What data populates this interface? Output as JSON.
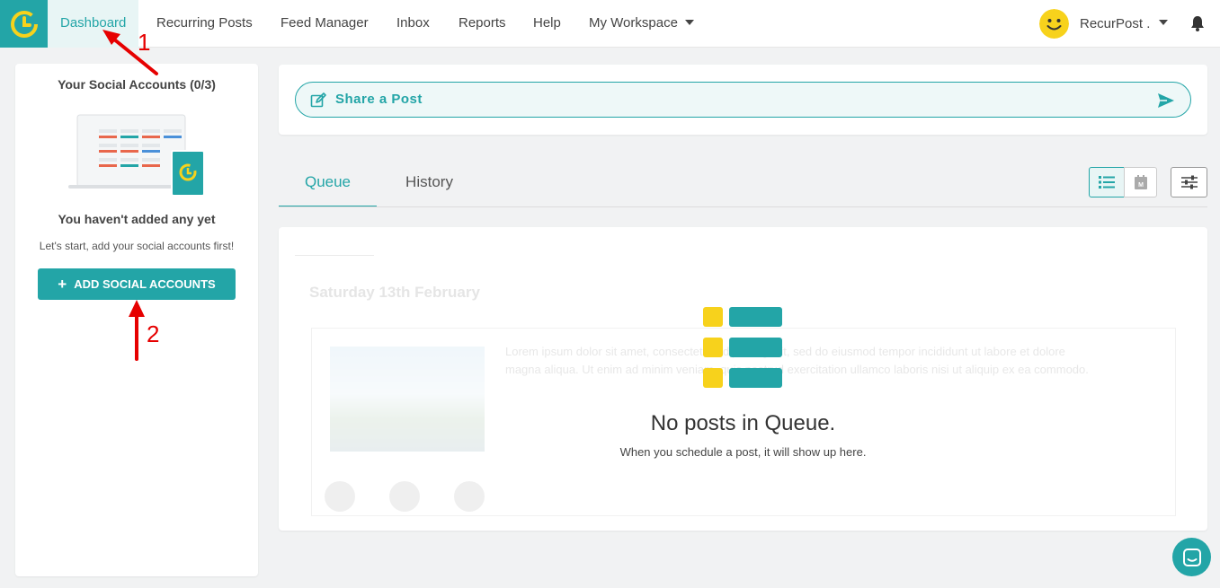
{
  "nav": {
    "logo_icon": "recurpost-clock-logo-icon",
    "items": [
      {
        "label": "Dashboard",
        "active": true
      },
      {
        "label": "Recurring Posts"
      },
      {
        "label": "Feed Manager"
      },
      {
        "label": "Inbox"
      },
      {
        "label": "Reports"
      },
      {
        "label": "Help"
      },
      {
        "label": "My Workspace"
      }
    ],
    "user_name": "RecurPost .",
    "user_avatar_icon": "smiley-face-icon",
    "bell_icon": "bell-icon"
  },
  "sidebar": {
    "title": "Your Social Accounts (0/3)",
    "empty_title": "You haven't added any yet",
    "empty_subtitle": "Let's start, add your social accounts first!",
    "add_button_label": "ADD SOCIAL ACCOUNTS"
  },
  "share": {
    "label": "Share a Post",
    "edit_icon": "edit-icon",
    "send_icon": "send-icon"
  },
  "tabs": [
    {
      "label": "Queue",
      "active": true
    },
    {
      "label": "History"
    }
  ],
  "view_buttons": {
    "list_icon": "list-view-icon",
    "calendar_icon": "calendar-view-icon",
    "filter_icon": "sliders-filter-icon"
  },
  "queue": {
    "empty_title": "No posts in Queue.",
    "empty_subtitle": "When you schedule a post, it will show up here.",
    "placeholder_date": "Saturday 13th February",
    "placeholder_text": "Lorem ipsum dolor sit amet, consectetur adipiscing elit, sed do eiusmod tempor incididunt ut labore et dolore magna aliqua. Ut enim ad minim veniam, quis nostrud exercitation ullamco laboris nisi ut aliquip ex ea commodo."
  },
  "annotations": {
    "marker_1": "1",
    "marker_2": "2"
  },
  "colors": {
    "brand": "#23a5a7",
    "accent_yellow": "#f7d21c",
    "annotation_red": "#e60000"
  }
}
